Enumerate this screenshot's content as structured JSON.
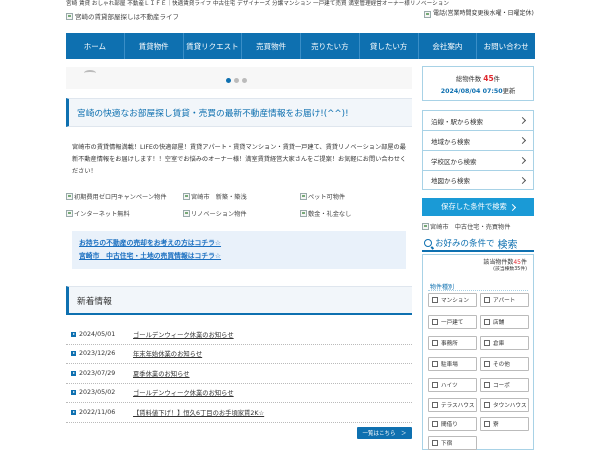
{
  "header": {
    "tagline": "宮崎 賃貸 おしゃれ部屋 不動産ＬＩＦＥ｜快適賃貸ライフ 中古住宅 デザイナーズ 分譲マンション 一戸建て売買 満室管理経営オーナー様リノベーション",
    "logo_alt": "宮崎の賃貸部屋探しは不動産ライフ",
    "phone_alt": "電話(営業時間変更後水曜・日曜定休)"
  },
  "nav": {
    "items": [
      "ホーム",
      "賃貸物件",
      "賃貸リクエスト",
      "売買物件",
      "売りたい方",
      "貸したい方",
      "会社案内",
      "お問い合わせ"
    ]
  },
  "counter": {
    "label": "総物件数",
    "count": "45",
    "unit": "件",
    "datetime": "2024/08/04 07:50",
    "updated": "更新"
  },
  "headline": "宮崎の快適なお部屋探し賃貸・売買の最新不動産情報をお届け!(^^)!",
  "intro": "宮崎市の賃貸情報満載！LIFEの快適部屋！賃貸アパート・賃貸マンション・賃貸一戸建て、賃貸リノベーション部屋の最新不動産情報をお届けします！！空室でお悩みのオーナー様！満室賃貸経営大家さんをご提案！お気軽にお問い合わせください！",
  "links": [
    "初期費用ゼロ円キャンペーン物件",
    "宮崎市　新築・築浅",
    "ペット可物件",
    "インターネット無料",
    "リノベーション物件",
    "敷金・礼金なし"
  ],
  "sale": {
    "line1": "お持ちの不動産の売却をお考えの方はコチラ☆",
    "line2": "宮崎市　中古住宅・土地の売買情報はコチラ☆"
  },
  "news": {
    "heading": "新着情報",
    "items": [
      {
        "date": "2024/05/01",
        "title": "ゴールデンウィーク休業のお知らせ"
      },
      {
        "date": "2023/12/26",
        "title": "年末年始休業のお知らせ"
      },
      {
        "date": "2023/07/29",
        "title": "夏季休業のお知らせ"
      },
      {
        "date": "2023/05/02",
        "title": "ゴールデンウィーク休業のお知らせ"
      },
      {
        "date": "2022/11/06",
        "title": "【賃料値下げ！】恒久6丁目のお手頃家賃2K☆"
      }
    ],
    "more_label": "一覧はこちら　＞"
  },
  "sidebar": {
    "search_links": [
      "沿線・駅から検索",
      "地域から検索",
      "学校区から検索",
      "地図から検索"
    ],
    "saved_label": "保存した条件で検索",
    "miyazaki_link": "宮崎市　中古住宅・売買物件"
  },
  "filter": {
    "title_prefix": "お好みの条件で",
    "title_big": "検索",
    "hits_label": "該当物件数",
    "hits_count": "45",
    "hits_unit": "件",
    "hits_sub": "(該当棟数35件)",
    "category_label": "物件種別",
    "types": [
      "マンション",
      "アパート",
      "一戸建て",
      "店舗",
      "事務所",
      "倉庫",
      "駐車場",
      "その他",
      "ハイツ",
      "コーポ",
      "テラスハウス",
      "タウンハウス",
      "間借り",
      "寮",
      "下宿"
    ]
  },
  "colors": {
    "nav_bg": "#0e70b0",
    "accent_red": "#e0282e",
    "saved_button": "#1a9ad6"
  }
}
